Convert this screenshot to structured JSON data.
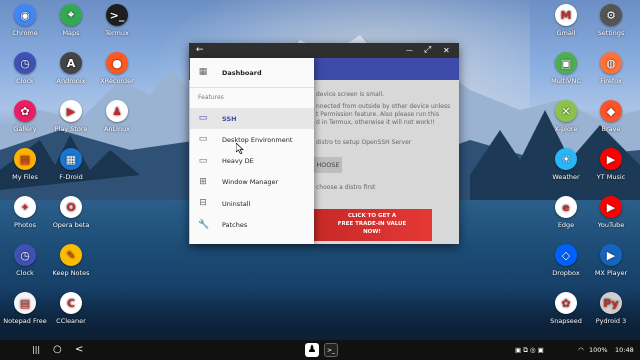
{
  "desktop": {
    "left_icons": [
      {
        "label": "Chrome",
        "glyph": "◉",
        "color": "#4285f4"
      },
      {
        "label": "Maps",
        "glyph": "⌖",
        "color": "#34a853"
      },
      {
        "label": "Termux",
        "glyph": ">_",
        "color": "#1e1e1e"
      },
      {
        "label": "Clock",
        "glyph": "◷",
        "color": "#3f51b5"
      },
      {
        "label": "Andronix",
        "glyph": "A",
        "color": "#444"
      },
      {
        "label": "XRecorder",
        "glyph": "●",
        "color": "#ff5722"
      },
      {
        "label": "Gallery",
        "glyph": "✿",
        "color": "#e91e63"
      },
      {
        "label": "Play Store",
        "glyph": "▶",
        "color": "#ffffff"
      },
      {
        "label": "AnLinux",
        "glyph": "♟",
        "color": "#ffffff"
      },
      {
        "label": "My Files",
        "glyph": "▤",
        "color": "#ffb300"
      },
      {
        "label": "F-Droid",
        "glyph": "▦",
        "color": "#1976d2"
      },
      {
        "label": "Photos",
        "glyph": "✦",
        "color": "#ffffff"
      },
      {
        "label": "Opera beta",
        "glyph": "O",
        "color": "#ffffff"
      },
      {
        "label": "Clock",
        "glyph": "◷",
        "color": "#3f51b5"
      },
      {
        "label": "Keep Notes",
        "glyph": "✎",
        "color": "#fbbc04"
      },
      {
        "label": "Notepad Free",
        "glyph": "▤",
        "color": "#f5f5f5"
      },
      {
        "label": "CCleaner",
        "glyph": "C",
        "color": "#ffffff"
      }
    ],
    "right_icons": [
      {
        "label": "Gmail",
        "glyph": "M",
        "color": "#ffffff"
      },
      {
        "label": "Settings",
        "glyph": "⚙",
        "color": "#555"
      },
      {
        "label": "MultiVNC",
        "glyph": "▣",
        "color": "#4caf50"
      },
      {
        "label": "Firefox",
        "glyph": "◍",
        "color": "#ff7139"
      },
      {
        "label": "X-plore",
        "glyph": "✕",
        "color": "#8bc34a"
      },
      {
        "label": "Brave",
        "glyph": "◆",
        "color": "#fb542b"
      },
      {
        "label": "Weather",
        "glyph": "☀",
        "color": "#29b6f6"
      },
      {
        "label": "YT Music",
        "glyph": "▶",
        "color": "#ff0000"
      },
      {
        "label": "Edge",
        "glyph": "e",
        "color": "#ffffff"
      },
      {
        "label": "YouTube",
        "glyph": "▶",
        "color": "#ff0000"
      },
      {
        "label": "Dropbox",
        "glyph": "◇",
        "color": "#0061ff"
      },
      {
        "label": "MX Player",
        "glyph": "▶",
        "color": "#1565c0"
      },
      {
        "label": "Snapseed",
        "glyph": "✿",
        "color": "#ffffff"
      },
      {
        "label": "Pydroid 3",
        "glyph": "Py",
        "color": "#cfcfcf"
      }
    ]
  },
  "window": {
    "back_glyph": "←",
    "minimize_glyph": "—",
    "maximize_glyph": "⤢",
    "close_glyph": "✕",
    "content_lines": [
      "device screen is small.",
      "nnected from outside by other device unless",
      "t Permission feature. Also please run this",
      "d in Termux, otherwise it will not work!!",
      "distro to setup OpenSSH Server",
      "choose a distro first"
    ],
    "choose_button": "HOOSE",
    "ad_lines": [
      "CLICK TO GET A",
      "FREE TRADE-IN VALUE",
      "NOW!"
    ]
  },
  "drawer": {
    "dashboard": {
      "label": "Dashboard",
      "icon": "▦"
    },
    "section_title": "Features",
    "items": [
      {
        "label": "SSH",
        "icon": "▭",
        "active": true
      },
      {
        "label": "Desktop Environment",
        "icon": "▭",
        "active": false
      },
      {
        "label": "Heavy DE",
        "icon": "▭",
        "active": false
      },
      {
        "label": "Window Manager",
        "icon": "⊞",
        "active": false
      },
      {
        "label": "Uninstall",
        "icon": "⊟",
        "active": false
      },
      {
        "label": "Patches",
        "icon": "🔧",
        "active": false
      }
    ]
  },
  "taskbar": {
    "menu_glyph": "|||",
    "home_glyph": "○",
    "back_glyph": "<",
    "pinned": [
      {
        "label": "AnLinux",
        "glyph": "♟"
      },
      {
        "label": "Termux",
        "glyph": ">_"
      }
    ],
    "battery": "100%",
    "time": "10:48"
  },
  "colors": {
    "accent": "#3d4aa8",
    "window_bar": "#2f2f2f"
  }
}
